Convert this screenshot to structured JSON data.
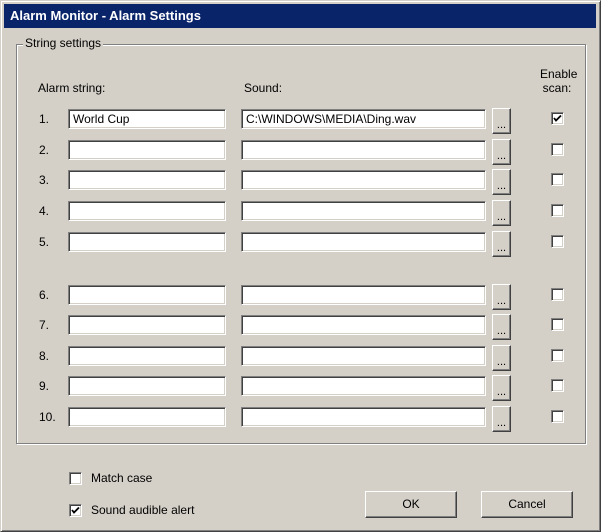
{
  "window": {
    "title": "Alarm Monitor - Alarm Settings"
  },
  "group": {
    "label": "String settings"
  },
  "headers": {
    "alarm_string": "Alarm string:",
    "sound": "Sound:",
    "enable_scan_line1": "Enable",
    "enable_scan_line2": "scan:"
  },
  "rows": [
    {
      "num": "1.",
      "alarm": "World Cup",
      "sound": "C:\\WINDOWS\\MEDIA\\Ding.wav",
      "browse": "...",
      "enabled": true
    },
    {
      "num": "2.",
      "alarm": "",
      "sound": "",
      "browse": "...",
      "enabled": false
    },
    {
      "num": "3.",
      "alarm": "",
      "sound": "",
      "browse": "...",
      "enabled": false
    },
    {
      "num": "4.",
      "alarm": "",
      "sound": "",
      "browse": "...",
      "enabled": false
    },
    {
      "num": "5.",
      "alarm": "",
      "sound": "",
      "browse": "...",
      "enabled": false
    },
    {
      "num": "6.",
      "alarm": "",
      "sound": "",
      "browse": "...",
      "enabled": false
    },
    {
      "num": "7.",
      "alarm": "",
      "sound": "",
      "browse": "...",
      "enabled": false
    },
    {
      "num": "8.",
      "alarm": "",
      "sound": "",
      "browse": "...",
      "enabled": false
    },
    {
      "num": "9.",
      "alarm": "",
      "sound": "",
      "browse": "...",
      "enabled": false
    },
    {
      "num": "10.",
      "alarm": "",
      "sound": "",
      "browse": "...",
      "enabled": false
    }
  ],
  "options": {
    "match_case": {
      "label": "Match case",
      "checked": false
    },
    "sound_audible_alert": {
      "label": "Sound audible alert",
      "checked": true
    }
  },
  "buttons": {
    "ok": "OK",
    "cancel": "Cancel"
  }
}
